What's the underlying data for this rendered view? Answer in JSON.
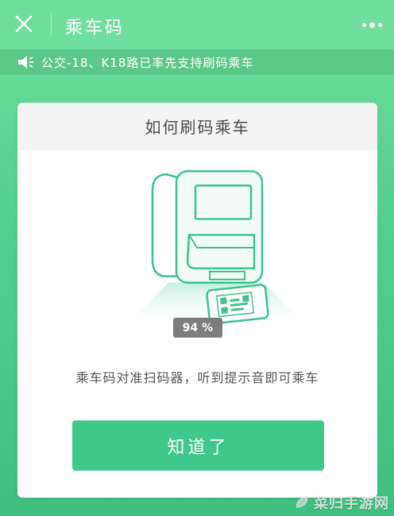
{
  "header": {
    "title": "乘车码"
  },
  "notice": {
    "text": "公交-18、K18路已率先支持刷码乘车"
  },
  "card": {
    "title": "如何刷码乘车",
    "progress": "94 %",
    "progress_value": 94,
    "instruction": "乘车码对准扫码器，听到提示音即可乘车",
    "button_label": "知道了"
  },
  "watermark": {
    "text": "菜归手游网"
  },
  "colors": {
    "accent": "#3ec98a",
    "header_bg": "#70de9c",
    "notice_bg": "#5cc887",
    "illustration_stroke": "#3cc38f"
  },
  "icons": {
    "close": "close-icon",
    "more": "more-icon",
    "speaker": "speaker-icon"
  }
}
